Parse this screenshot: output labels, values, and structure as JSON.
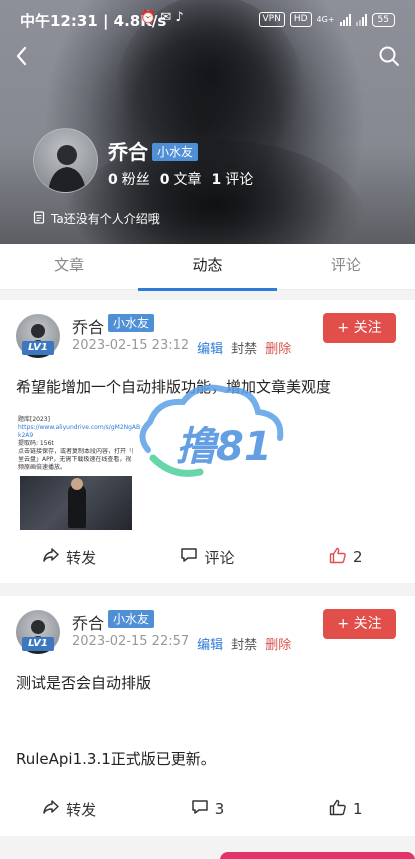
{
  "status_bar": {
    "time": "中午12:31 | 4.8K/s",
    "vpn": "VPN",
    "hd": "HD",
    "net": "4G+",
    "battery": "55"
  },
  "profile": {
    "name": "乔合",
    "badge": "小水友",
    "fans_count": "0",
    "fans_label": "粉丝",
    "articles_count": "0",
    "articles_label": "文章",
    "comments_count": "1",
    "comments_label": "评论",
    "bio": "Ta还没有个人介绍哦"
  },
  "tabs": [
    {
      "label": "文章",
      "active": false
    },
    {
      "label": "动态",
      "active": true
    },
    {
      "label": "评论",
      "active": false
    }
  ],
  "posts": [
    {
      "author": "乔合",
      "badge": "小水友",
      "level": "LV1",
      "time": "2023-02-15 23:12",
      "edit": "编辑",
      "ban": "封禁",
      "delete": "删除",
      "follow": "+ 关注",
      "text": "希望能增加一个自动排版功能，增加文章美观度",
      "repost": "转发",
      "comment": "评论",
      "likes": "2",
      "attachment": {
        "line1": "题库[2023]",
        "line2": "https://www.aliyundrive.com/s/gM2NgAB",
        "line3": "k2A9",
        "line4": "提取码: 156t",
        "line5": "点击链接保存，或者复制本段内容，打开「阿",
        "line6": "里云盘」APP，无需下载极速在线查看，视",
        "line7": "频原画倍速播放。"
      }
    },
    {
      "author": "乔合",
      "badge": "小水友",
      "level": "LV1",
      "time": "2023-02-15 22:57",
      "edit": "编辑",
      "ban": "封禁",
      "delete": "删除",
      "follow": "+ 关注",
      "text": "测试是否会自动排版",
      "text2": "RuleApi1.3.1正式版已更新。",
      "repost": "转发",
      "comments": "3",
      "likes": "1"
    }
  ],
  "watermark": "撸81",
  "colors": {
    "accent_blue": "#2f7bd8",
    "badge_blue": "#4e8fd6",
    "follow_red": "#e24e4a",
    "delete_red": "#d9534f"
  },
  "icons": [
    "back-arrow-icon",
    "search-icon",
    "document-icon",
    "share-icon",
    "comment-icon",
    "thumbs-up-icon"
  ]
}
